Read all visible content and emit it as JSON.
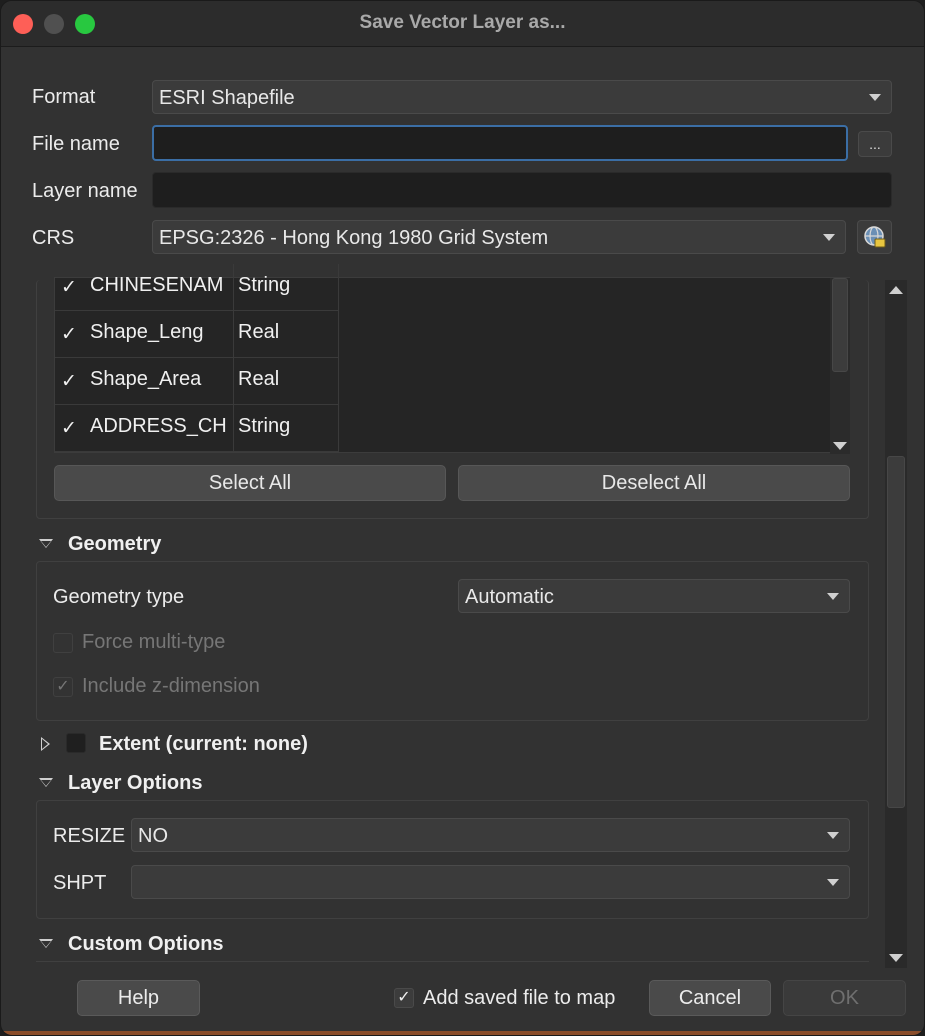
{
  "window": {
    "title": "Save Vector Layer as..."
  },
  "form": {
    "format_label": "Format",
    "format_value": "ESRI Shapefile",
    "filename_label": "File name",
    "filename_value": "",
    "browse_label": "...",
    "layername_label": "Layer name",
    "layername_value": "",
    "crs_label": "CRS",
    "crs_value": "EPSG:2326 - Hong Kong 1980 Grid System"
  },
  "fields": {
    "rows": [
      {
        "name": "CHINESENAM",
        "type": "String",
        "checked": "✓"
      },
      {
        "name": "Shape_Leng",
        "type": "Real",
        "checked": "✓"
      },
      {
        "name": "Shape_Area",
        "type": "Real",
        "checked": "✓"
      },
      {
        "name": "ADDRESS_CH",
        "type": "String",
        "checked": "✓"
      }
    ],
    "select_all": "Select All",
    "deselect_all": "Deselect All"
  },
  "geometry": {
    "header": "Geometry",
    "type_label": "Geometry type",
    "type_value": "Automatic",
    "force_multi": "Force multi-type",
    "include_z": "Include z-dimension",
    "include_z_check": "✓"
  },
  "extent": {
    "header": "Extent (current: none)"
  },
  "layer_options": {
    "header": "Layer Options",
    "resize_label": "RESIZE",
    "resize_value": "NO",
    "shpt_label": "SHPT",
    "shpt_value": ""
  },
  "custom_options": {
    "header": "Custom Options"
  },
  "footer": {
    "help": "Help",
    "add_to_map_check": "✓",
    "add_to_map": "Add saved file to map",
    "cancel": "Cancel",
    "ok": "OK"
  },
  "colors": {
    "accent_focus": "#3b6ea5",
    "close": "#fe5f57",
    "maximize": "#28c840"
  }
}
